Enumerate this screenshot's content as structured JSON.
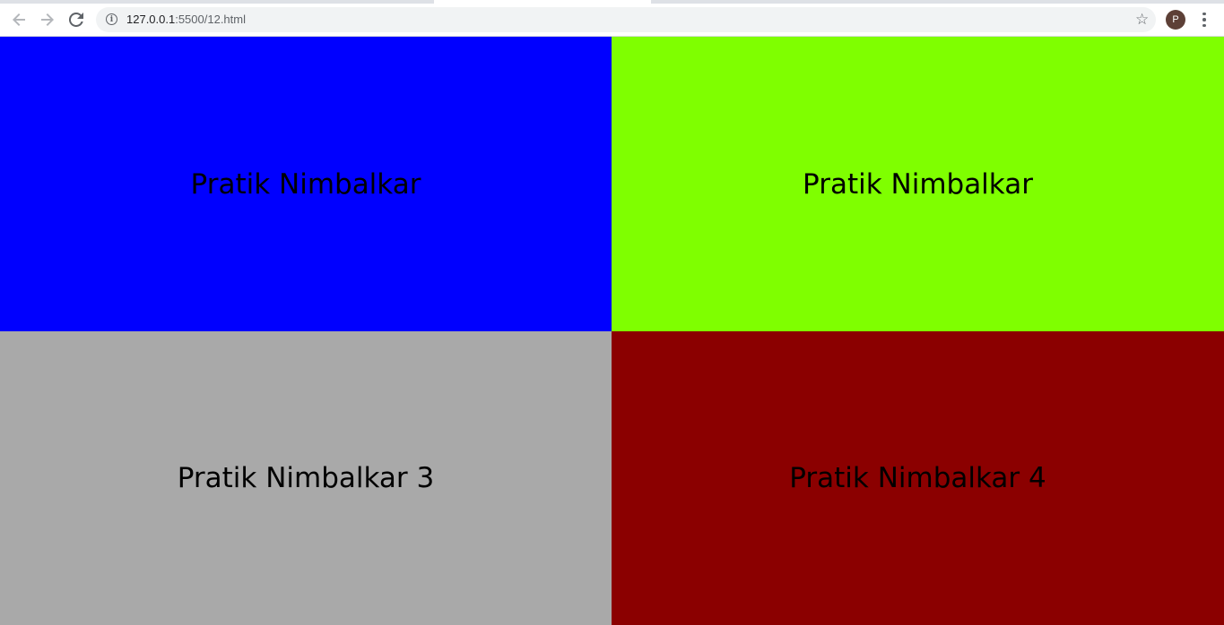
{
  "browser": {
    "back_icon": "arrow-left-icon",
    "forward_icon": "arrow-right-icon",
    "reload_icon": "reload-icon",
    "info_icon": "info-icon",
    "url_host": "127.0.0.1",
    "url_rest": ":5500/12.html",
    "bookmark_icon": "star-icon",
    "profile_initial": "P",
    "menu_icon": "more-vert-icon"
  },
  "boxes": [
    {
      "label": "Pratik Nimbalkar",
      "color": "#0000ff"
    },
    {
      "label": "Pratik Nimbalkar",
      "color": "#7fff00"
    },
    {
      "label": "Pratik Nimbalkar 3",
      "color": "#a9a9a9"
    },
    {
      "label": "Pratik Nimbalkar 4",
      "color": "#8b0000"
    }
  ]
}
